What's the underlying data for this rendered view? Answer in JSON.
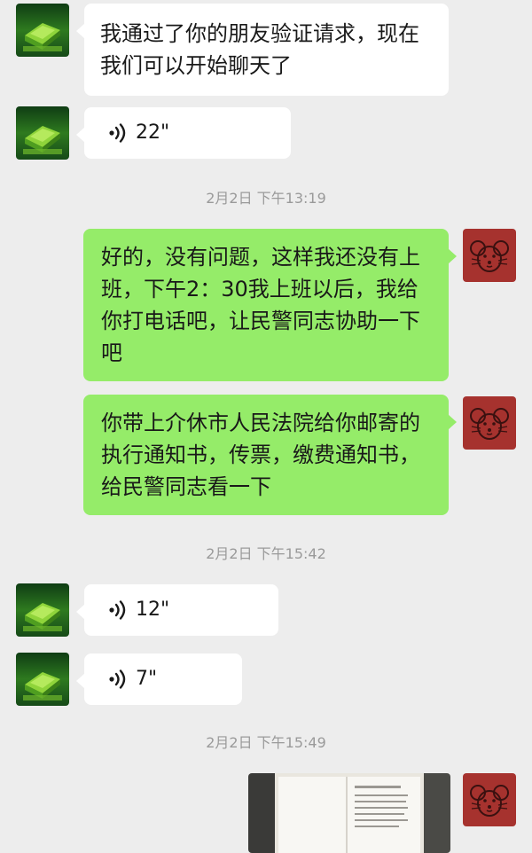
{
  "messages": {
    "m1_text": "我通过了你的朋友验证请求，现在我们可以开始聊天了",
    "m2_voice": "22\"",
    "time1": "2月2日 下午13:19",
    "m3_text": "好的，没有问题，这样我还没有上班，下午2：30我上班以后，我给你打电话吧，让民警同志协助一下吧",
    "m4_text": "你带上介休市人民法院给你邮寄的执行通知书，传票，缴费通知书，给民警同志看一下",
    "time2": "2月2日 下午15:42",
    "m5_voice": "12\"",
    "m6_voice": "7\"",
    "time3": "2月2日 下午15:49"
  },
  "colors": {
    "background": "#ededed",
    "incoming_bubble": "#ffffff",
    "outgoing_bubble": "#95ec69",
    "timestamp": "#9a9a9a",
    "my_avatar": "#a6322e"
  },
  "icons": {
    "contact_avatar": "green-book-avatar",
    "my_avatar": "mouse-face-avatar",
    "voice": "voice-wave-icon"
  }
}
